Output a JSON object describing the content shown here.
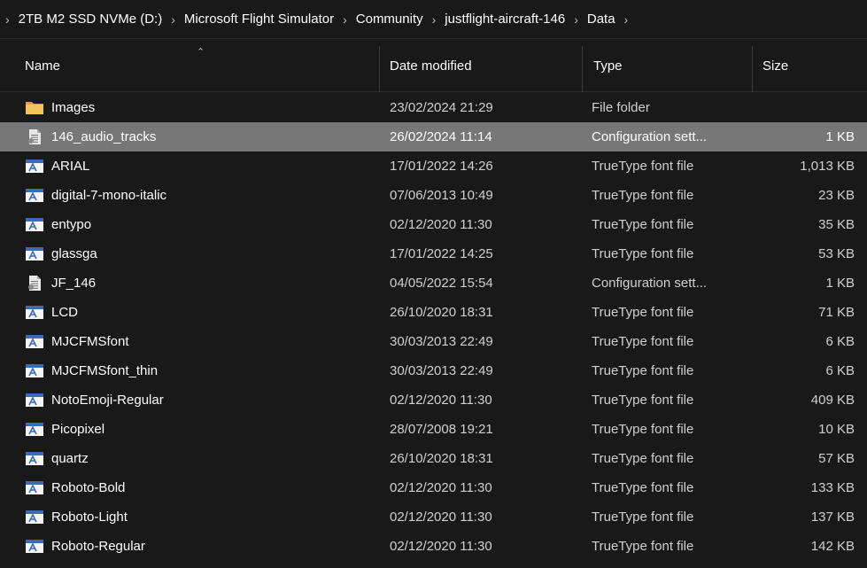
{
  "breadcrumb": {
    "items": [
      "2TB M2 SSD NVMe (D:)",
      "Microsoft Flight Simulator",
      "Community",
      "justflight-aircraft-146",
      "Data"
    ]
  },
  "columns": {
    "name": "Name",
    "date": "Date modified",
    "type": "Type",
    "size": "Size"
  },
  "files": [
    {
      "name": "Images",
      "date": "23/02/2024 21:29",
      "type": "File folder",
      "size": "",
      "icon": "folder-icon",
      "selected": false
    },
    {
      "name": "146_audio_tracks",
      "date": "26/02/2024 11:14",
      "type": "Configuration sett...",
      "size": "1 KB",
      "icon": "config-file-icon",
      "selected": true
    },
    {
      "name": "ARIAL",
      "date": "17/01/2022 14:26",
      "type": "TrueType font file",
      "size": "1,013 KB",
      "icon": "font-file-icon",
      "selected": false
    },
    {
      "name": "digital-7-mono-italic",
      "date": "07/06/2013 10:49",
      "type": "TrueType font file",
      "size": "23 KB",
      "icon": "font-file-icon",
      "selected": false
    },
    {
      "name": "entypo",
      "date": "02/12/2020 11:30",
      "type": "TrueType font file",
      "size": "35 KB",
      "icon": "font-file-icon",
      "selected": false
    },
    {
      "name": "glassga",
      "date": "17/01/2022 14:25",
      "type": "TrueType font file",
      "size": "53 KB",
      "icon": "font-file-icon",
      "selected": false
    },
    {
      "name": "JF_146",
      "date": "04/05/2022 15:54",
      "type": "Configuration sett...",
      "size": "1 KB",
      "icon": "config-file-icon",
      "selected": false
    },
    {
      "name": "LCD",
      "date": "26/10/2020 18:31",
      "type": "TrueType font file",
      "size": "71 KB",
      "icon": "font-file-icon",
      "selected": false
    },
    {
      "name": "MJCFMSfont",
      "date": "30/03/2013 22:49",
      "type": "TrueType font file",
      "size": "6 KB",
      "icon": "font-file-icon",
      "selected": false
    },
    {
      "name": "MJCFMSfont_thin",
      "date": "30/03/2013 22:49",
      "type": "TrueType font file",
      "size": "6 KB",
      "icon": "font-file-icon",
      "selected": false
    },
    {
      "name": "NotoEmoji-Regular",
      "date": "02/12/2020 11:30",
      "type": "TrueType font file",
      "size": "409 KB",
      "icon": "font-file-icon",
      "selected": false
    },
    {
      "name": "Picopixel",
      "date": "28/07/2008 19:21",
      "type": "TrueType font file",
      "size": "10 KB",
      "icon": "font-file-icon",
      "selected": false
    },
    {
      "name": "quartz",
      "date": "26/10/2020 18:31",
      "type": "TrueType font file",
      "size": "57 KB",
      "icon": "font-file-icon",
      "selected": false
    },
    {
      "name": "Roboto-Bold",
      "date": "02/12/2020 11:30",
      "type": "TrueType font file",
      "size": "133 KB",
      "icon": "font-file-icon",
      "selected": false
    },
    {
      "name": "Roboto-Light",
      "date": "02/12/2020 11:30",
      "type": "TrueType font file",
      "size": "137 KB",
      "icon": "font-file-icon",
      "selected": false
    },
    {
      "name": "Roboto-Regular",
      "date": "02/12/2020 11:30",
      "type": "TrueType font file",
      "size": "142 KB",
      "icon": "font-file-icon",
      "selected": false
    }
  ],
  "colors": {
    "background": "#191919",
    "selected_row": "#777777",
    "folder": "#f2c55c",
    "font_icon": "#3d6bb3"
  }
}
